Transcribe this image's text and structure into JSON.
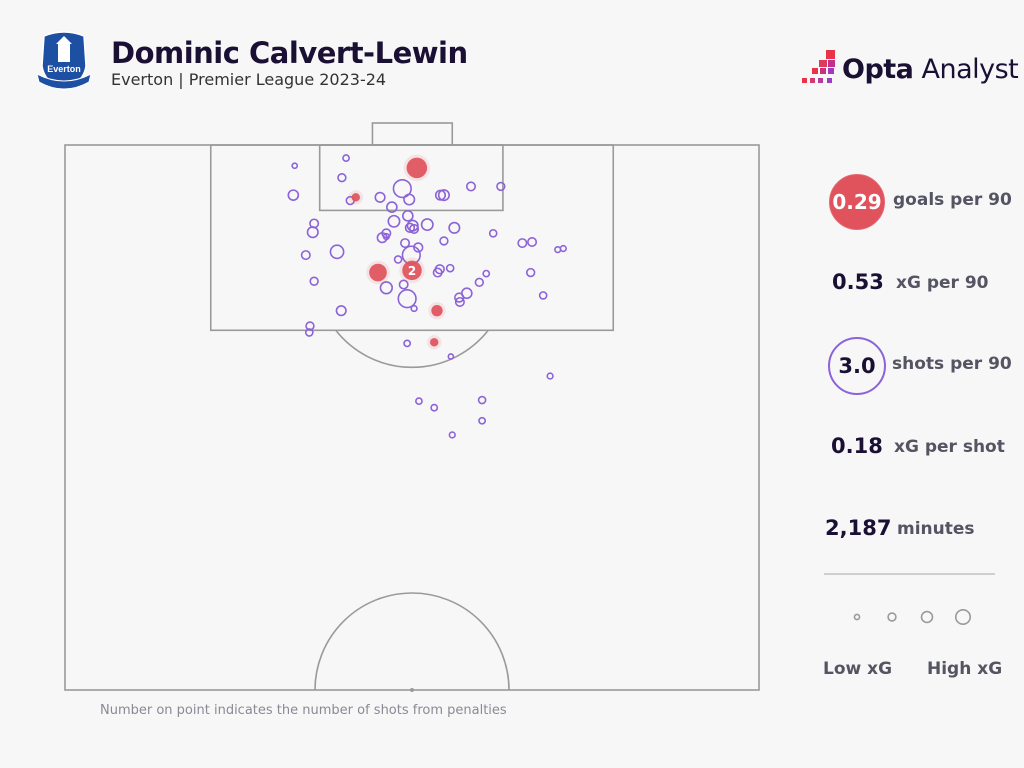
{
  "header": {
    "title": "Dominic Calvert-Lewin",
    "subtitle": "Everton | Premier League 2023-24",
    "club_crest_text": "Everton 1878 NIL SATIS NISI OPTIMUM",
    "brand_logo": {
      "bold": "Opta",
      "regular": " Analyst"
    }
  },
  "stats": [
    {
      "value": "0.29",
      "label": "goals per 90",
      "style": "goal-circle"
    },
    {
      "value": "0.53",
      "label": "xG per 90",
      "style": "plain"
    },
    {
      "value": "3.0",
      "label": "shots per 90",
      "style": "shot-circle"
    },
    {
      "value": "0.18",
      "label": "xG per shot",
      "style": "plain"
    },
    {
      "value": "2,187",
      "label": "minutes",
      "style": "plain"
    }
  ],
  "legend": {
    "low": "Low xG",
    "high": "High xG",
    "sample_xg": [
      0.01,
      0.04,
      0.1,
      0.2
    ]
  },
  "footnote": "Number on point indicates the number of shots from penalties",
  "colors": {
    "background": "#f7f7f7",
    "shot": "#8c63d8",
    "goal": "#e0525c",
    "pitch_line": "#9a9a9a",
    "text": "#1a1033",
    "crest": "#1d4fa3"
  },
  "chart_data": {
    "type": "scatter",
    "description_units": "Opta pitch coordinates (x 0-100 across pitch width, y 0-50 distance from goal line to halfway line); size = xG",
    "xlim": [
      0,
      100
    ],
    "ylim": [
      0,
      50
    ],
    "shots": [
      {
        "x": 33.1,
        "y": 1.9,
        "xg": 0.01,
        "goal": false
      },
      {
        "x": 40.5,
        "y": 1.2,
        "xg": 0.02,
        "goal": false
      },
      {
        "x": 39.9,
        "y": 3.0,
        "xg": 0.04,
        "goal": false
      },
      {
        "x": 32.9,
        "y": 4.6,
        "xg": 0.08,
        "goal": false
      },
      {
        "x": 41.1,
        "y": 5.1,
        "xg": 0.04,
        "goal": false
      },
      {
        "x": 41.9,
        "y": 4.8,
        "xg": 0.05,
        "goal": true
      },
      {
        "x": 45.4,
        "y": 4.8,
        "xg": 0.07,
        "goal": false
      },
      {
        "x": 48.6,
        "y": 4.0,
        "xg": 0.32,
        "goal": false
      },
      {
        "x": 49.6,
        "y": 5.0,
        "xg": 0.09,
        "goal": false
      },
      {
        "x": 50.7,
        "y": 2.1,
        "xg": 0.45,
        "goal": true
      },
      {
        "x": 54.6,
        "y": 4.6,
        "xg": 0.09,
        "goal": false
      },
      {
        "x": 54.1,
        "y": 4.6,
        "xg": 0.07,
        "goal": false
      },
      {
        "x": 58.5,
        "y": 3.8,
        "xg": 0.05,
        "goal": false
      },
      {
        "x": 62.8,
        "y": 3.8,
        "xg": 0.04,
        "goal": false
      },
      {
        "x": 47.1,
        "y": 5.7,
        "xg": 0.08,
        "goal": false
      },
      {
        "x": 49.4,
        "y": 6.5,
        "xg": 0.08,
        "goal": false
      },
      {
        "x": 47.4,
        "y": 7.0,
        "xg": 0.11,
        "goal": false
      },
      {
        "x": 35.9,
        "y": 7.2,
        "xg": 0.05,
        "goal": false
      },
      {
        "x": 35.7,
        "y": 8.0,
        "xg": 0.09,
        "goal": false
      },
      {
        "x": 49.7,
        "y": 7.6,
        "xg": 0.055,
        "goal": false
      },
      {
        "x": 50.3,
        "y": 7.7,
        "xg": 0.05,
        "goal": false
      },
      {
        "x": 50.1,
        "y": 7.4,
        "xg": 0.09,
        "goal": false
      },
      {
        "x": 52.2,
        "y": 7.3,
        "xg": 0.11,
        "goal": false
      },
      {
        "x": 56.1,
        "y": 7.6,
        "xg": 0.09,
        "goal": false
      },
      {
        "x": 46.3,
        "y": 8.1,
        "xg": 0.05,
        "goal": false
      },
      {
        "x": 45.7,
        "y": 8.5,
        "xg": 0.07,
        "goal": false
      },
      {
        "x": 46.3,
        "y": 8.4,
        "xg": 0.015,
        "goal": false
      },
      {
        "x": 61.7,
        "y": 8.1,
        "xg": 0.03,
        "goal": false
      },
      {
        "x": 65.9,
        "y": 9.0,
        "xg": 0.05,
        "goal": false
      },
      {
        "x": 67.3,
        "y": 8.9,
        "xg": 0.05,
        "goal": false
      },
      {
        "x": 71.0,
        "y": 9.6,
        "xg": 0.015,
        "goal": false
      },
      {
        "x": 71.8,
        "y": 9.5,
        "xg": 0.015,
        "goal": false
      },
      {
        "x": 34.7,
        "y": 10.1,
        "xg": 0.05,
        "goal": false
      },
      {
        "x": 39.2,
        "y": 9.8,
        "xg": 0.16,
        "goal": false
      },
      {
        "x": 49.0,
        "y": 9.0,
        "xg": 0.05,
        "goal": false
      },
      {
        "x": 50.9,
        "y": 9.4,
        "xg": 0.055,
        "goal": false
      },
      {
        "x": 54.6,
        "y": 8.8,
        "xg": 0.04,
        "goal": false
      },
      {
        "x": 49.9,
        "y": 10.1,
        "xg": 0.32,
        "goal": false
      },
      {
        "x": 48.0,
        "y": 10.5,
        "xg": 0.03,
        "goal": false
      },
      {
        "x": 50.0,
        "y": 11.5,
        "xg": 0.4,
        "goal": true,
        "penalties": "2"
      },
      {
        "x": 45.1,
        "y": 11.7,
        "xg": 0.32,
        "goal": true
      },
      {
        "x": 54.0,
        "y": 11.4,
        "xg": 0.055,
        "goal": false
      },
      {
        "x": 53.7,
        "y": 11.7,
        "xg": 0.05,
        "goal": false
      },
      {
        "x": 55.5,
        "y": 11.3,
        "xg": 0.03,
        "goal": false
      },
      {
        "x": 35.9,
        "y": 12.5,
        "xg": 0.04,
        "goal": false
      },
      {
        "x": 46.3,
        "y": 13.1,
        "xg": 0.12,
        "goal": false
      },
      {
        "x": 48.8,
        "y": 12.8,
        "xg": 0.05,
        "goal": false
      },
      {
        "x": 49.3,
        "y": 14.1,
        "xg": 0.32,
        "goal": false
      },
      {
        "x": 50.3,
        "y": 15.0,
        "xg": 0.015,
        "goal": false
      },
      {
        "x": 59.7,
        "y": 12.6,
        "xg": 0.04,
        "goal": false
      },
      {
        "x": 60.7,
        "y": 11.8,
        "xg": 0.02,
        "goal": false
      },
      {
        "x": 57.9,
        "y": 13.6,
        "xg": 0.08,
        "goal": false
      },
      {
        "x": 56.8,
        "y": 14.0,
        "xg": 0.055,
        "goal": false
      },
      {
        "x": 56.9,
        "y": 14.4,
        "xg": 0.05,
        "goal": false
      },
      {
        "x": 67.1,
        "y": 11.7,
        "xg": 0.04,
        "goal": false
      },
      {
        "x": 68.9,
        "y": 13.8,
        "xg": 0.03,
        "goal": false
      },
      {
        "x": 39.8,
        "y": 15.2,
        "xg": 0.07,
        "goal": false
      },
      {
        "x": 53.6,
        "y": 15.2,
        "xg": 0.11,
        "goal": true
      },
      {
        "x": 35.3,
        "y": 16.6,
        "xg": 0.04,
        "goal": false
      },
      {
        "x": 35.2,
        "y": 17.2,
        "xg": 0.03,
        "goal": false
      },
      {
        "x": 49.3,
        "y": 18.2,
        "xg": 0.02,
        "goal": false
      },
      {
        "x": 53.2,
        "y": 18.1,
        "xg": 0.05,
        "goal": true
      },
      {
        "x": 55.6,
        "y": 19.4,
        "xg": 0.01,
        "goal": false
      },
      {
        "x": 69.9,
        "y": 21.2,
        "xg": 0.015,
        "goal": false
      },
      {
        "x": 51.0,
        "y": 23.5,
        "xg": 0.02,
        "goal": false
      },
      {
        "x": 53.2,
        "y": 24.1,
        "xg": 0.02,
        "goal": false
      },
      {
        "x": 60.1,
        "y": 23.4,
        "xg": 0.03,
        "goal": false
      },
      {
        "x": 60.1,
        "y": 25.3,
        "xg": 0.02,
        "goal": false
      },
      {
        "x": 55.8,
        "y": 26.6,
        "xg": 0.015,
        "goal": false
      }
    ]
  }
}
